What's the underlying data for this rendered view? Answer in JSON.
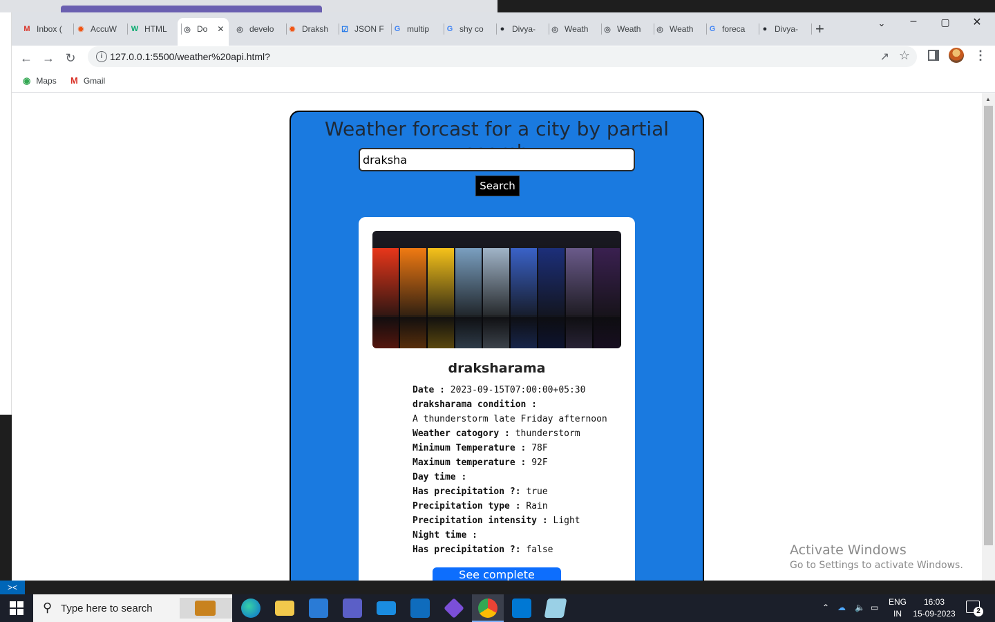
{
  "browser": {
    "tabs": [
      {
        "label": "Inbox (",
        "icon": "gmail-icon",
        "color": "#d93025"
      },
      {
        "label": "AccuW",
        "icon": "accuweather-icon",
        "color": "#f05514"
      },
      {
        "label": "HTML",
        "icon": "w3schools-icon",
        "color": "#04aa6d"
      },
      {
        "label": "Do",
        "icon": "globe-icon",
        "color": "#5f6368",
        "active": true
      },
      {
        "label": "develo",
        "icon": "globe-icon",
        "color": "#5f6368"
      },
      {
        "label": "Draksh",
        "icon": "accuweather-icon",
        "color": "#f05514"
      },
      {
        "label": "JSON F",
        "icon": "checkbox-icon",
        "color": "#1a73e8"
      },
      {
        "label": "multip",
        "icon": "google-icon",
        "color": "#4285f4"
      },
      {
        "label": "shy co",
        "icon": "google-icon",
        "color": "#4285f4"
      },
      {
        "label": "Divya-",
        "icon": "github-icon",
        "color": "#24292f"
      },
      {
        "label": "Weath",
        "icon": "globe-icon",
        "color": "#5f6368"
      },
      {
        "label": "Weath",
        "icon": "globe-icon",
        "color": "#5f6368"
      },
      {
        "label": "Weath",
        "icon": "globe-icon",
        "color": "#5f6368"
      },
      {
        "label": "foreca",
        "icon": "google-icon",
        "color": "#4285f4"
      },
      {
        "label": "Divya-",
        "icon": "github-icon",
        "color": "#24292f"
      }
    ],
    "url": "127.0.0.1:5500/weather%20api.html?",
    "bookmarks": [
      {
        "label": "Maps",
        "icon": "maps-icon"
      },
      {
        "label": "Gmail",
        "icon": "gmail-icon"
      }
    ]
  },
  "page": {
    "heading": "Weather forcast for a city by partial search",
    "search_value": "draksha",
    "search_button": "Search",
    "card": {
      "title": "draksharama",
      "rows": [
        {
          "label": "Date : ",
          "value": "2023-09-15T07:00:00+05:30"
        },
        {
          "label": "draksharama condition :",
          "value": ""
        },
        {
          "label": "",
          "value": "A thunderstorm late Friday afternoon"
        },
        {
          "label": "Weather catogory : ",
          "value": " thunderstorm"
        },
        {
          "label": "Minimum Temperature : ",
          "value": " 78F"
        },
        {
          "label": "Maximum temperature : ",
          "value": " 92F"
        },
        {
          "label": "Day time :",
          "value": ""
        },
        {
          "label": "Has precipitation ?: ",
          "value": " true"
        },
        {
          "label": "Precipitation type : ",
          "value": " Rain"
        },
        {
          "label": "Precipitation intensity : ",
          "value": " Light"
        },
        {
          "label": "Night time :",
          "value": ""
        },
        {
          "label": "Has precipitation ?: ",
          "value": " false"
        }
      ],
      "stats_button": "See complete statistics"
    }
  },
  "watermark": {
    "line1": "Activate Windows",
    "line2": "Go to Settings to activate Windows."
  },
  "taskbar": {
    "search_placeholder": "Type here to search",
    "lang_line1": "ENG",
    "lang_line2": "IN",
    "time": "16:03",
    "date": "15-09-2023",
    "notifications": "2"
  },
  "colors": {
    "page_bg": "#1a7ae0",
    "stats_button": "#0d6efd",
    "search_button": "#000000"
  }
}
